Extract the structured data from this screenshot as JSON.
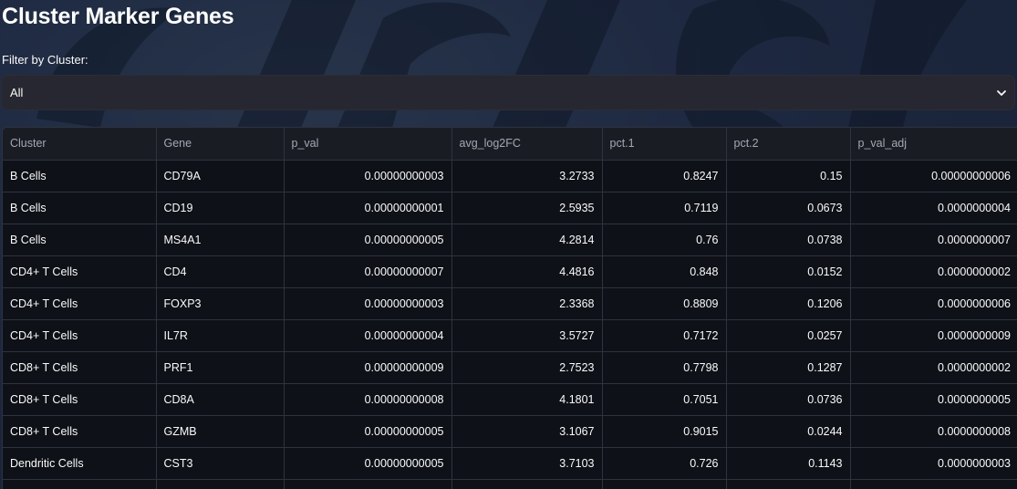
{
  "page": {
    "title": "Cluster Marker Genes"
  },
  "filter": {
    "label": "Filter by Cluster:",
    "selected": "All"
  },
  "table": {
    "columns": [
      "Cluster",
      "Gene",
      "p_val",
      "avg_log2FC",
      "pct.1",
      "pct.2",
      "p_val_adj"
    ],
    "rows": [
      [
        "B Cells",
        "CD79A",
        "0.00000000003",
        "3.2733",
        "0.8247",
        "0.15",
        "0.00000000006"
      ],
      [
        "B Cells",
        "CD19",
        "0.00000000001",
        "2.5935",
        "0.7119",
        "0.0673",
        "0.0000000004"
      ],
      [
        "B Cells",
        "MS4A1",
        "0.00000000005",
        "4.2814",
        "0.76",
        "0.0738",
        "0.0000000007"
      ],
      [
        "CD4+ T Cells",
        "CD4",
        "0.00000000007",
        "4.4816",
        "0.848",
        "0.0152",
        "0.0000000002"
      ],
      [
        "CD4+ T Cells",
        "FOXP3",
        "0.00000000003",
        "2.3368",
        "0.8809",
        "0.1206",
        "0.0000000006"
      ],
      [
        "CD4+ T Cells",
        "IL7R",
        "0.00000000004",
        "3.5727",
        "0.7172",
        "0.0257",
        "0.0000000009"
      ],
      [
        "CD8+ T Cells",
        "PRF1",
        "0.00000000009",
        "2.7523",
        "0.7798",
        "0.1287",
        "0.0000000002"
      ],
      [
        "CD8+ T Cells",
        "CD8A",
        "0.00000000008",
        "4.1801",
        "0.7051",
        "0.0736",
        "0.0000000005"
      ],
      [
        "CD8+ T Cells",
        "GZMB",
        "0.00000000005",
        "3.1067",
        "0.9015",
        "0.0244",
        "0.0000000008"
      ],
      [
        "Dendritic Cells",
        "CST3",
        "0.00000000005",
        "3.7103",
        "0.726",
        "0.1143",
        "0.0000000003"
      ],
      [
        "",
        "",
        "",
        "",
        "",
        "",
        ""
      ]
    ]
  },
  "colors": {
    "background": "#1c2738",
    "table_background": "#0e1117",
    "header_background": "#1a1c24",
    "select_background": "#262730"
  },
  "icons": {
    "select_arrow": "chevron-down-icon"
  }
}
